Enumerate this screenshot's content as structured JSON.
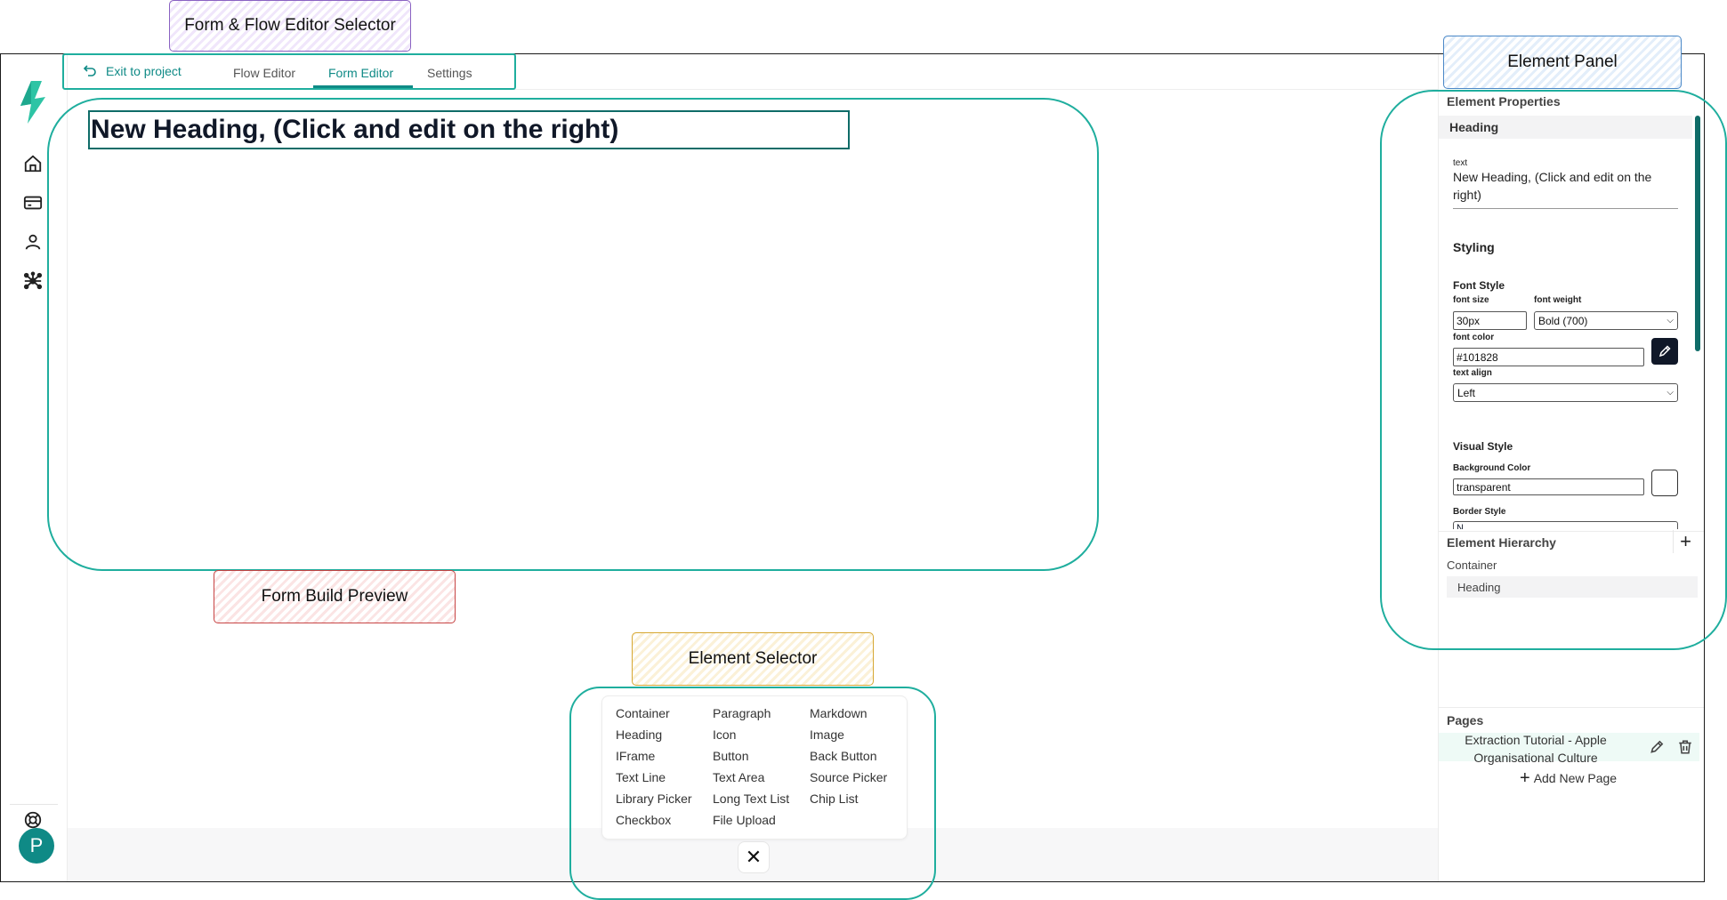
{
  "annotations": {
    "form_flow_selector": "Form & Flow Editor Selector",
    "element_panel": "Element Panel",
    "form_build_preview": "Form Build Preview",
    "element_selector": "Element Selector"
  },
  "header": {
    "exit_label": "Exit to project",
    "tabs": [
      {
        "label": "Flow Editor",
        "active": false
      },
      {
        "label": "Form Editor",
        "active": true
      },
      {
        "label": "Settings",
        "active": false
      }
    ]
  },
  "nav": {
    "icons": [
      "logo-icon",
      "home-icon",
      "card-icon",
      "user-icon",
      "network-icon",
      "help-icon"
    ],
    "avatar_letter": "P"
  },
  "preview": {
    "heading": "New Heading, (Click and edit on the right)"
  },
  "element_selector": {
    "columns": [
      [
        "Container",
        "Heading",
        "IFrame",
        "Text Line",
        "Library Picker",
        "Checkbox"
      ],
      [
        "Paragraph",
        "Icon",
        "Button",
        "Text Area",
        "Long Text List",
        "File Upload"
      ],
      [
        "Markdown",
        "Image",
        "Back Button",
        "Source Picker",
        "Chip List"
      ]
    ],
    "close_symbol": "✕"
  },
  "properties": {
    "title": "Element Properties",
    "element_type": "Heading",
    "text_label": "text",
    "text_value": "New Heading, (Click and edit on the right)",
    "styling": "Styling",
    "font_style": "Font Style",
    "font_size_label": "font size",
    "font_size_value": "30px",
    "font_weight_label": "font weight",
    "font_weight_value": "Bold (700)",
    "font_color_label": "font color",
    "font_color_value": "#101828",
    "text_align_label": "text align",
    "text_align_value": "Left",
    "visual_style": "Visual Style",
    "bg_color_label": "Background Color",
    "bg_color_value": "transparent",
    "border_style_label": "Border Style",
    "border_style_value": "N"
  },
  "hierarchy": {
    "title": "Element Hierarchy",
    "add_symbol": "+",
    "items": [
      "Container",
      "Heading"
    ]
  },
  "pages": {
    "title": "Pages",
    "items": [
      "Extraction Tutorial - Apple Organisational Culture"
    ],
    "add_label": "Add New Page"
  },
  "colors": {
    "accent": "#0f8a86",
    "annotation_teal": "#1fae9e",
    "text": "#101828"
  }
}
